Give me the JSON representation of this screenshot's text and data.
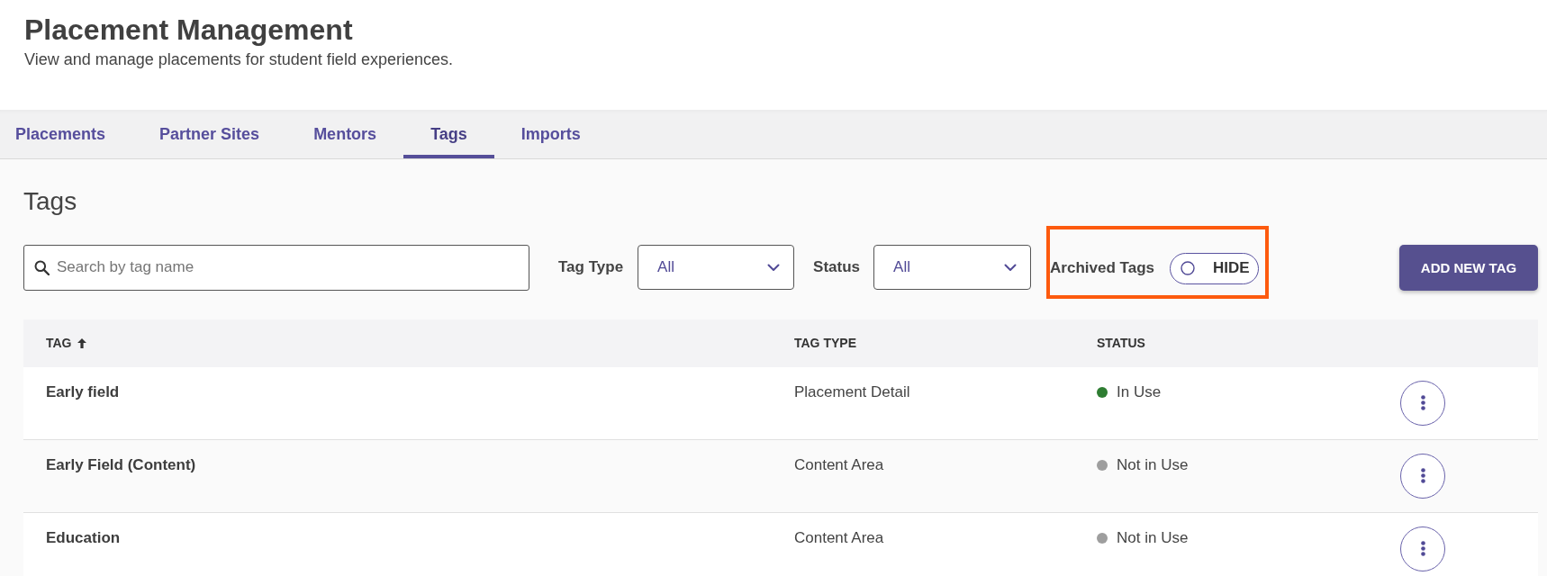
{
  "header": {
    "title": "Placement Management",
    "subtitle": "View and manage placements for student field experiences."
  },
  "tabs": [
    {
      "label": "Placements",
      "selected": false
    },
    {
      "label": "Partner Sites",
      "selected": false
    },
    {
      "label": "Mentors",
      "selected": false
    },
    {
      "label": "Tags",
      "selected": true
    },
    {
      "label": "Imports",
      "selected": false
    }
  ],
  "section": {
    "title": "Tags"
  },
  "filters": {
    "search": {
      "placeholder": "Search by tag name"
    },
    "selects": [
      {
        "label": "Tag Type",
        "value": "All"
      },
      {
        "label": "Status",
        "value": "All"
      }
    ],
    "archived": {
      "label": "Archived Tags",
      "toggle_text": "HIDE",
      "on": false,
      "highlighted": true
    },
    "add_button": "ADD NEW TAG"
  },
  "table": {
    "columns": [
      {
        "label": "TAG",
        "sorted": true
      },
      {
        "label": "TAG TYPE",
        "sorted": false
      },
      {
        "label": "STATUS",
        "sorted": false
      }
    ],
    "rows": [
      {
        "tag": "Early field",
        "tag_type": "Placement Detail",
        "status": "In Use",
        "color": "#2e7d32"
      },
      {
        "tag": "Early Field (Content)",
        "tag_type": "Content Area",
        "status": "Not in Use",
        "color": "#9e9e9e"
      },
      {
        "tag": "Education",
        "tag_type": "Content Area",
        "status": "Not in Use",
        "color": "#9e9e9e"
      }
    ]
  }
}
